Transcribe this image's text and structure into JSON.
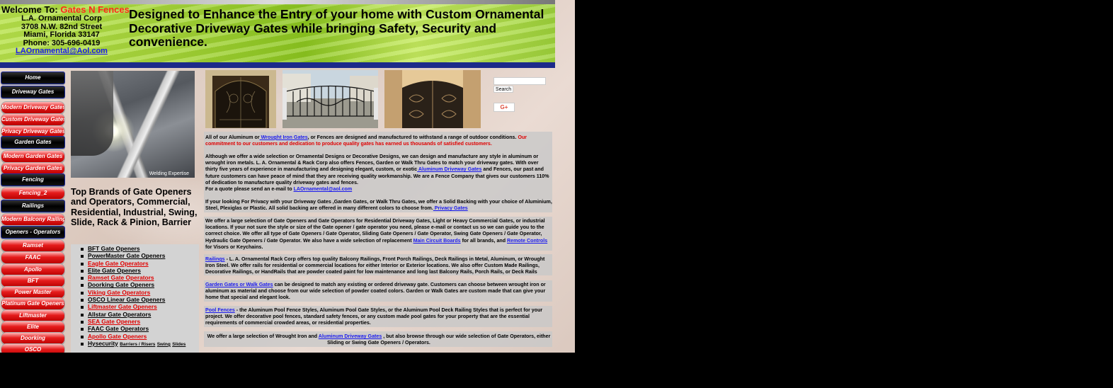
{
  "header": {
    "welcome_prefix": "Welcome To:",
    "brand": "Gates N Fences",
    "company": "L.A. Ornamental Corp",
    "street": "3708 N.W. 82nd Street",
    "city": "Miami, Florida 33147",
    "phone": "Phone: 305-696-0419",
    "email": "LAOrnamental@Aol.com",
    "tagline": "Designed to Enhance the Entry of your home with Custom Ornamental Decorative Driveway Gates while bringing Safety, Security and convenience."
  },
  "nav": [
    {
      "label": "Home",
      "style": "dark"
    },
    {
      "label": "Driveway Gates",
      "style": "dark"
    },
    {
      "label": "Modern Driveway Gates",
      "style": "red"
    },
    {
      "label": "Custom Driveway Gates",
      "style": "red"
    },
    {
      "label": "Privacy Driveway Gates",
      "style": "red"
    },
    {
      "label": "Garden Gates",
      "style": "dark"
    },
    {
      "label": "Modern Garden Gates",
      "style": "red"
    },
    {
      "label": "Privacy Garden Gates",
      "style": "red"
    },
    {
      "label": "Fencing",
      "style": "dark"
    },
    {
      "label": "Fencing_2",
      "style": "red"
    },
    {
      "label": "Railings",
      "style": "dark"
    },
    {
      "label": "Modern Balcony Railings",
      "style": "red"
    },
    {
      "label": "Openers - Operators",
      "style": "dark"
    },
    {
      "label": "Ramset",
      "style": "red"
    },
    {
      "label": "FAAC",
      "style": "red"
    },
    {
      "label": "Apollo",
      "style": "red"
    },
    {
      "label": "BFT",
      "style": "red"
    },
    {
      "label": "Power Master",
      "style": "red"
    },
    {
      "label": "Platinum Gate Openers",
      "style": "red"
    },
    {
      "label": "Liftmaster",
      "style": "red"
    },
    {
      "label": "Elite",
      "style": "red"
    },
    {
      "label": "Doorking",
      "style": "red"
    },
    {
      "label": "OSCO",
      "style": "red"
    }
  ],
  "weld_caption": "Welding Expertise",
  "brands_title": "Top Brands of Gate Openers and Operators, Commercial, Residential, Industrial, Swing, Slide, Rack & Pinion, Barrier",
  "brands": [
    {
      "label": "BFT Gate Openers",
      "color": "black"
    },
    {
      "label": "PowerMaster Gate Openers",
      "color": "black"
    },
    {
      "label": "Eagle Gate Operators",
      "color": "red"
    },
    {
      "label": "Elite Gate Openers",
      "color": "black"
    },
    {
      "label": "Ramset Gate Operators",
      "color": "red"
    },
    {
      "label": "Doorking Gate Openers",
      "color": "black"
    },
    {
      "label": "Viking Gate Operators",
      "color": "red"
    },
    {
      "label": "OSCO Linear Gate Openers",
      "color": "black"
    },
    {
      "label": "Liftmaster Gate Openers",
      "color": "red"
    },
    {
      "label": "Allstar Gate Operators",
      "color": "black"
    },
    {
      "label": "SEA Gate Openers",
      "color": "red"
    },
    {
      "label": "FAAC Gate Operators",
      "color": "black"
    },
    {
      "label": "Apollo Gate Openers",
      "color": "red"
    }
  ],
  "hysecurity": {
    "label": "Hysecurity",
    "barriers": "Barriers / Risers",
    "swing": "Swing",
    "slides": "Slides"
  },
  "search": {
    "placeholder": "",
    "button": "Search"
  },
  "gplus": "G+",
  "content": {
    "p1a": "All of our Aluminum or",
    "p1link": " Wrought Iron Gates",
    "p1b": ", or Fences are designed and manufactured to withstand a range of outdoor conditions.",
    "p1red": " Our commitment to our customers and dedication to produce quality gates has earned us thousands of satisfied customers.",
    "p2a": "Although we offer a wide selection or Ornamental Designs or Decorative Designs, we can design and manufacture any style in aluminum or wrought iron metals. L. A. Ornamental & Rack Corp also offers Fences, Garden or Walk Thru Gates to match your driveway  gates. With over thirty five years of experience in manufacturing and designing elegant, custom, or exotic",
    "p2link": " Aluminum Driveway Gates",
    "p2b": " and Fences, our past and future customers can have peace of mind that they are receiving quality workmanship.  We are a Fence Company that gives our customers 110% of dedication to manufacture quality driveway gates and fences.",
    "p2c": "For a quote please send an e-mail to ",
    "p2email": "LAOrnamental@aol.com",
    "p3a": "If your looking For Privacy with your Driveway Gates ,Garden Gates, or Walk Thru Gates, we offer a Solid Backing with your choice of Aluminium, Steel, Plexiglas or Plastic.  All solid backing are offered in many different colors to choose from.",
    "p3link": " Privacy Gates",
    "p4a": "We offer a large selection of  Gate Openers and Gate Operators for Residential Driveway Gates, Light or Heavy Commercial Gates, or industrial locations. If your not sure the style or size of the Gate opener / gate operator  you need, please e-mail or contact us so we can guide you to the correct choice. We offer all type of Gate Openers / Gate Operator, Sliding Gate Openers / Gate Operator, Swing Gate Openers / Gate Operator, Hydraulic Gate Openers / Gate Operator. We also have a wide selection of replacement ",
    "p4link": "Main Circuit Boards",
    "p4b": " for all brands, and ",
    "p4link2": "Remote Controls",
    "p4c": "  for Visors or Keychains.",
    "p5link": "Railings",
    "p5a": " - L. A. Ornamental Rack Corp offers top quality Balcony Railings, Front Porch Railings, Deck Railings in Metal, Aluminum, or Wrought Iron Steel.  We offer rails for residential or commercial locations for either Interior or Exterior locations. We also offer Custom Made Railings, Decorative Railings, or HandRails that are powder coated paint for low maintenance and long last Balcony Rails, Porch Rails, or Deck Rails",
    "p6link": "Garden Gates or Walk Gates",
    "p6a": " can be designed to match any existing or ordered driveway gate.  Customers can choose between wrought iron or aluminum as material  and choose from our wide selection of powder coated colors.  Garden or Walk Gates are custom made that can give your home that special and elegant look.",
    "p7link": "Pool Fences",
    "p7a": " - the  Aluminum Pool Fence Styles, Aluminum Pool Gate Styles, or the Aluminum Pool Deck Railing Styles that is perfect for your project. We offer decorative pool fences, standard safety fences, or any custom made pool gates for your property that are the essential requirements of commercial crowded areas, or residential properties.",
    "p8a": "We offer a large selection of Wrought Iron and ",
    "p8link": "Aluminum Driveway Gates",
    "p8b": " , but also browse through our wide selection of Gate Operators, either Sliding or Swing Gate Openers / Operators."
  }
}
